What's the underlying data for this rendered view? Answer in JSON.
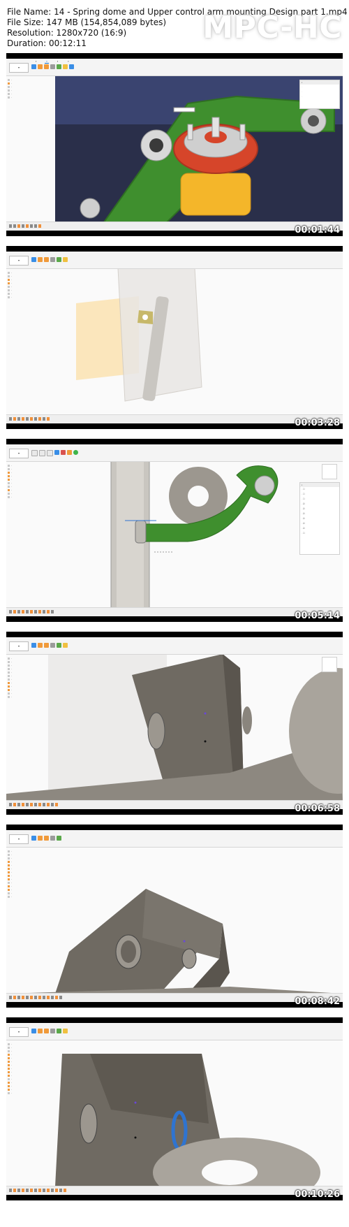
{
  "header": {
    "file_name": "File Name: 14 - Spring dome and Upper control arm mounting Design part 1.mp4",
    "file_size": "File Size: 147 MB (154,854,089 bytes)",
    "resolution": "Resolution: 1280x720 (16:9)",
    "duration": "Duration: 00:12:11"
  },
  "brand": "MPC-HC",
  "frames": [
    {
      "timestamp": "00:01:44"
    },
    {
      "timestamp": "00:03:28"
    },
    {
      "timestamp": "00:05:14"
    },
    {
      "timestamp": "00:06:58"
    },
    {
      "timestamp": "00:08:42"
    },
    {
      "timestamp": "00:10:26"
    }
  ],
  "colors": {
    "arm_green": "#3f8f2e",
    "spring_yellow": "#f4b62a",
    "dome_red": "#d6452a",
    "sheet_grey": "#6f6a62",
    "accent_blue": "#2f74d0",
    "highlight_orange": "#f0903a"
  }
}
